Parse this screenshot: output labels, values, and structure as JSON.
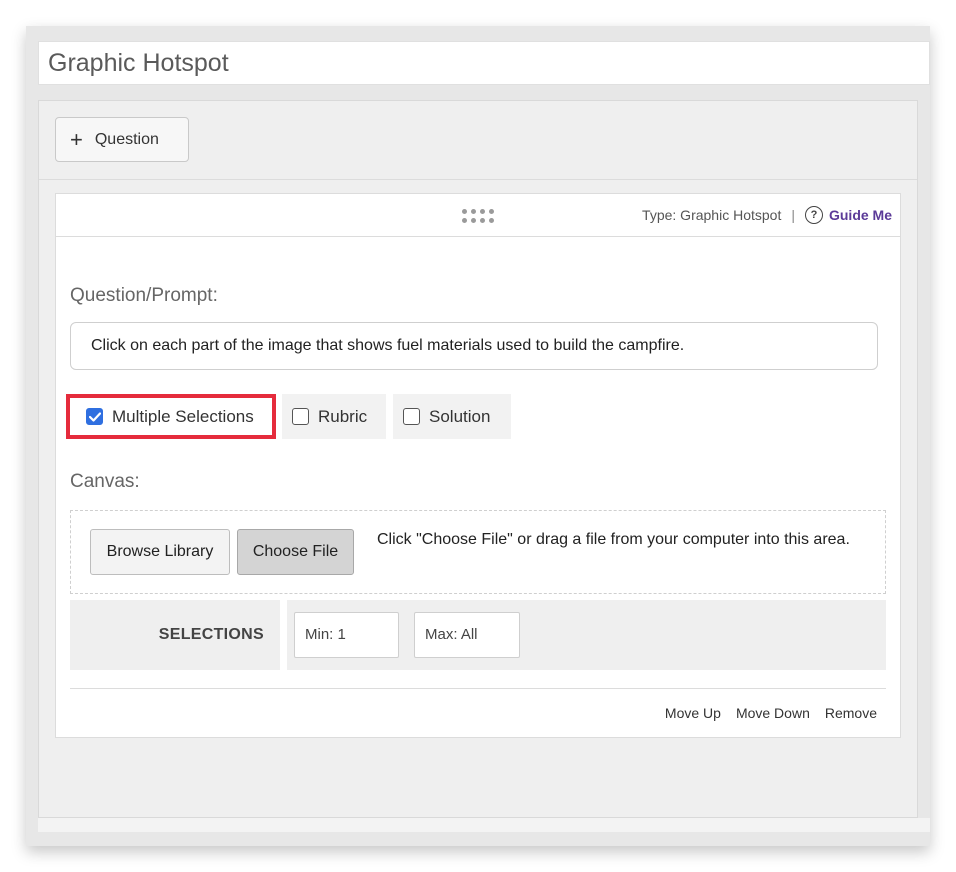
{
  "title_field": {
    "value": "Graphic Hotspot"
  },
  "toolbar": {
    "add_question_label": "Question"
  },
  "card": {
    "type_label": "Type: Graphic Hotspot",
    "separator": "|",
    "help_icon_glyph": "?",
    "guide_label": "Guide Me",
    "prompt_label": "Question/Prompt:",
    "prompt_value": "Click on each part of the image that shows fuel materials used to build the campfire.",
    "options": {
      "multiple_selections": {
        "label": "Multiple Selections",
        "checked": true
      },
      "rubric": {
        "label": "Rubric",
        "checked": false
      },
      "solution": {
        "label": "Solution",
        "checked": false
      }
    },
    "canvas_label": "Canvas:",
    "browse_label": "Browse Library",
    "choose_file_label": "Choose File",
    "drop_hint": "Click \"Choose File\" or drag a file from your computer into this area.",
    "selections": {
      "label": "SELECTIONS",
      "min_value": "Min: 1",
      "max_value": "Max: All"
    },
    "footer": {
      "move_up": "Move Up",
      "move_down": "Move Down",
      "remove": "Remove"
    }
  },
  "colors": {
    "highlight_border": "#e52b3c",
    "checkbox_checked": "#2f6fe0",
    "guide_link": "#5b3a98"
  },
  "icons": {
    "add": "plus-icon",
    "drag": "drag-handle-icon",
    "help": "help-circle-icon",
    "check": "checkmark-icon"
  }
}
